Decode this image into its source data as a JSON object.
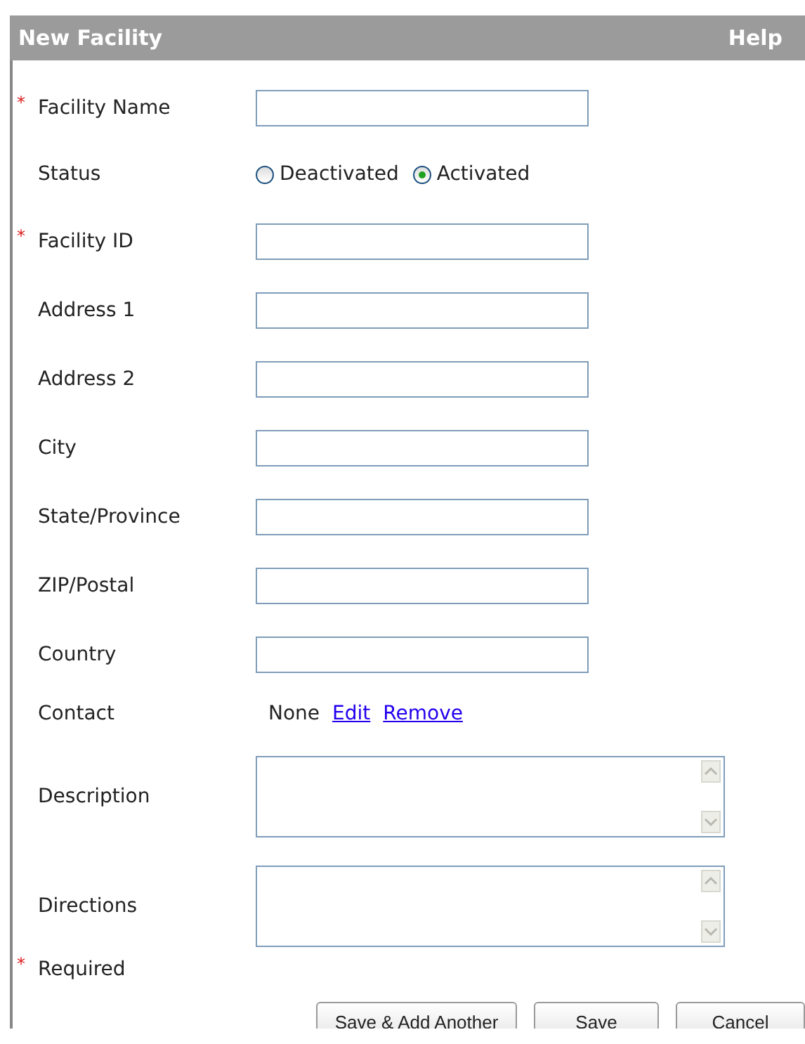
{
  "header": {
    "title": "New Facility",
    "help": "Help"
  },
  "fields": [
    {
      "kind": "text",
      "label": "Facility Name",
      "required_mark": "*"
    },
    {
      "kind": "radio",
      "label": "Status",
      "options": [
        {
          "label": "Deactivated",
          "selected": false
        },
        {
          "label": "Activated",
          "selected": true
        }
      ]
    },
    {
      "kind": "text",
      "label": "Facility ID",
      "required_mark": "*"
    },
    {
      "kind": "text",
      "label": "Address 1"
    },
    {
      "kind": "text",
      "label": "Address 2"
    },
    {
      "kind": "text",
      "label": "City"
    },
    {
      "kind": "text",
      "label": "State/Province"
    },
    {
      "kind": "text",
      "label": "ZIP/Postal"
    },
    {
      "kind": "text",
      "label": "Country"
    },
    {
      "kind": "contact",
      "label": "Contact",
      "value": "None",
      "links": [
        "Edit",
        "Remove"
      ]
    },
    {
      "kind": "textarea",
      "label": "Description"
    },
    {
      "kind": "textarea",
      "label": "Directions"
    }
  ],
  "footnote": {
    "mark": "*",
    "text": "Required"
  },
  "buttons": [
    "Save & Add Another",
    "Save",
    "Cancel"
  ]
}
